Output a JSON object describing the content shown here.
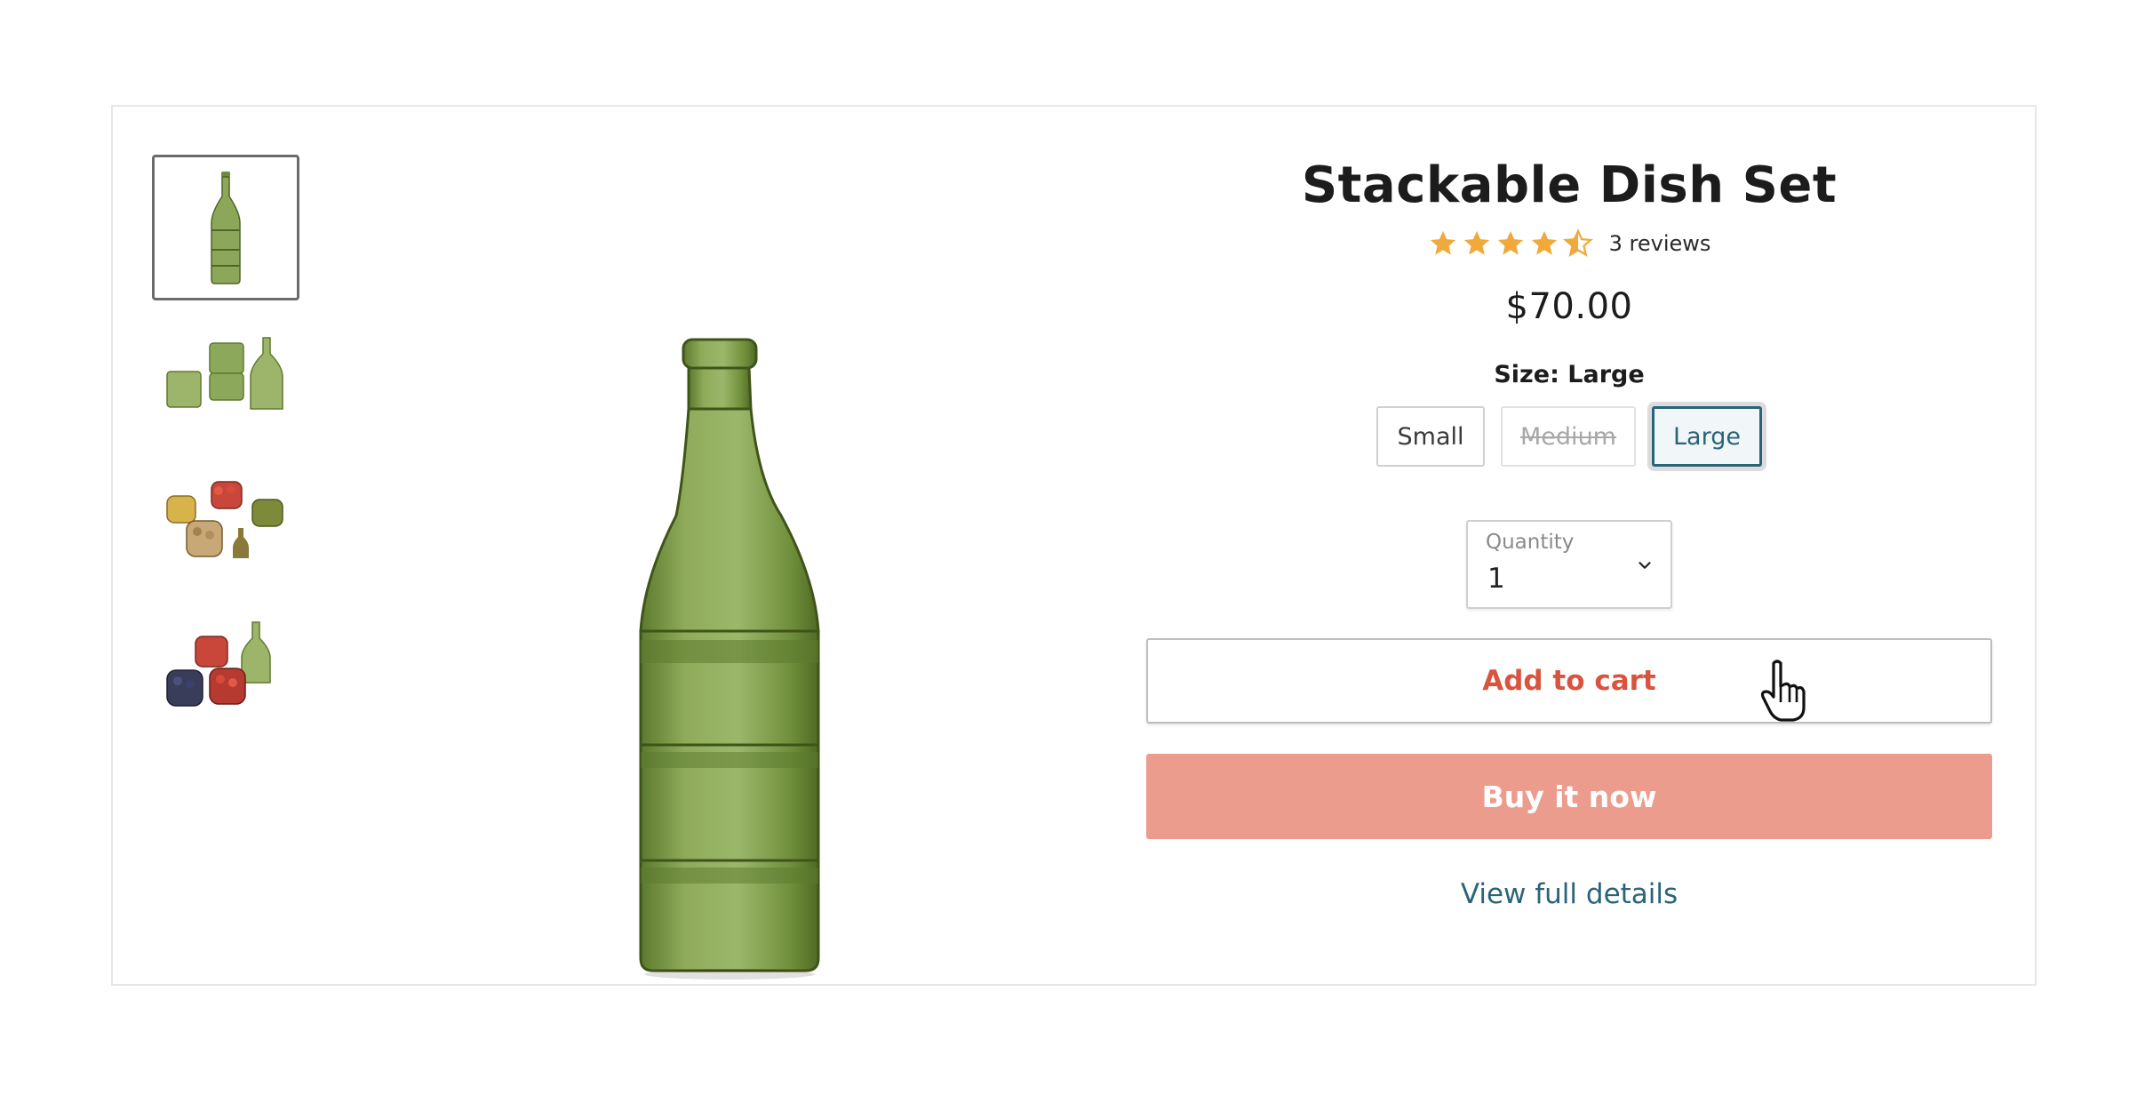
{
  "product": {
    "title": "Stackable Dish Set",
    "rating_value": 4.5,
    "rating_max": 5,
    "reviews_text": "3 reviews",
    "price": "$70.00"
  },
  "size": {
    "label": "Size: Large",
    "options": [
      {
        "label": "Small",
        "state": "available"
      },
      {
        "label": "Medium",
        "state": "unavailable"
      },
      {
        "label": "Large",
        "state": "selected"
      }
    ]
  },
  "quantity": {
    "label": "Quantity",
    "value": "1"
  },
  "actions": {
    "add_to_cart": "Add to cart",
    "buy_now": "Buy it now",
    "view_details": "View full details"
  },
  "colors": {
    "star": "#f0a93b",
    "accent_text": "#2a6478",
    "add_to_cart_text": "#d9543e",
    "buy_now_bg": "#ec9c8d",
    "glass_green": "#6f8a3c"
  },
  "gallery": {
    "thumbnails": [
      "bottle-stacked",
      "bowls-and-bottle",
      "bowls-with-nuts-and-fruit",
      "bowls-with-berries"
    ],
    "selected_index": 0
  }
}
